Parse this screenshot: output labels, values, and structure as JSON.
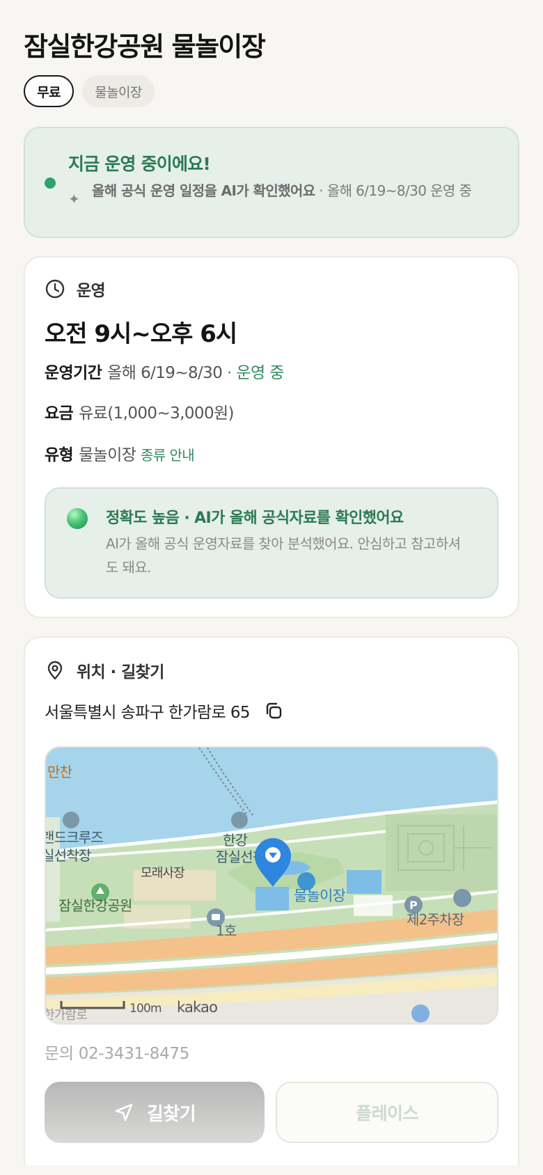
{
  "header": {
    "title": "잠실한강공원 물놀이장",
    "chips": [
      "무료",
      "물놀이장"
    ]
  },
  "status": {
    "title": "지금 운영 중이에요!",
    "desc_strong": "올해 공식 운영 일정을 AI가 확인했어요",
    "desc_rest": " · 올해 6/19~8/30 운영 중"
  },
  "operation": {
    "section_label": "운영",
    "hours": "오전 9시~오후 6시",
    "period_key": "운영기간",
    "period_value": "올해 6/19~8/30",
    "period_status": "· 운영 중",
    "fee_key": "요금",
    "fee_value": "유료(1,000~3,000원)",
    "type_key": "유형",
    "type_value": "물놀이장",
    "type_link": "종류 안내",
    "accuracy_title": "정확도 높음 · AI가 올해 공식자료를 확인했어요",
    "accuracy_desc": "AI가 올해 공식 운영자료를 찾아 분석했어요. 안심하고 참고하셔도 돼요."
  },
  "location": {
    "section_label": "위치 · 길찾기",
    "address": "서울특별시 송파구 한가람로 65",
    "phone": "문의 02-3431-8475",
    "map": {
      "labels": {
        "top_left": "만찬",
        "cruise1": "랜드크루즈",
        "cruise2": "실선착장",
        "sand": "모래사장",
        "park": "잠실한강공원",
        "pier1": "한강",
        "pier2": "잠실선착장",
        "pool": "물놀이장",
        "lot1": "1호",
        "lot2": "제2주차장",
        "road": "한가람로",
        "scale": "100m",
        "logo": "kakao",
        "parking_glyph": "P"
      }
    }
  },
  "actions": {
    "route": "길찾기",
    "place": "플레이스"
  }
}
